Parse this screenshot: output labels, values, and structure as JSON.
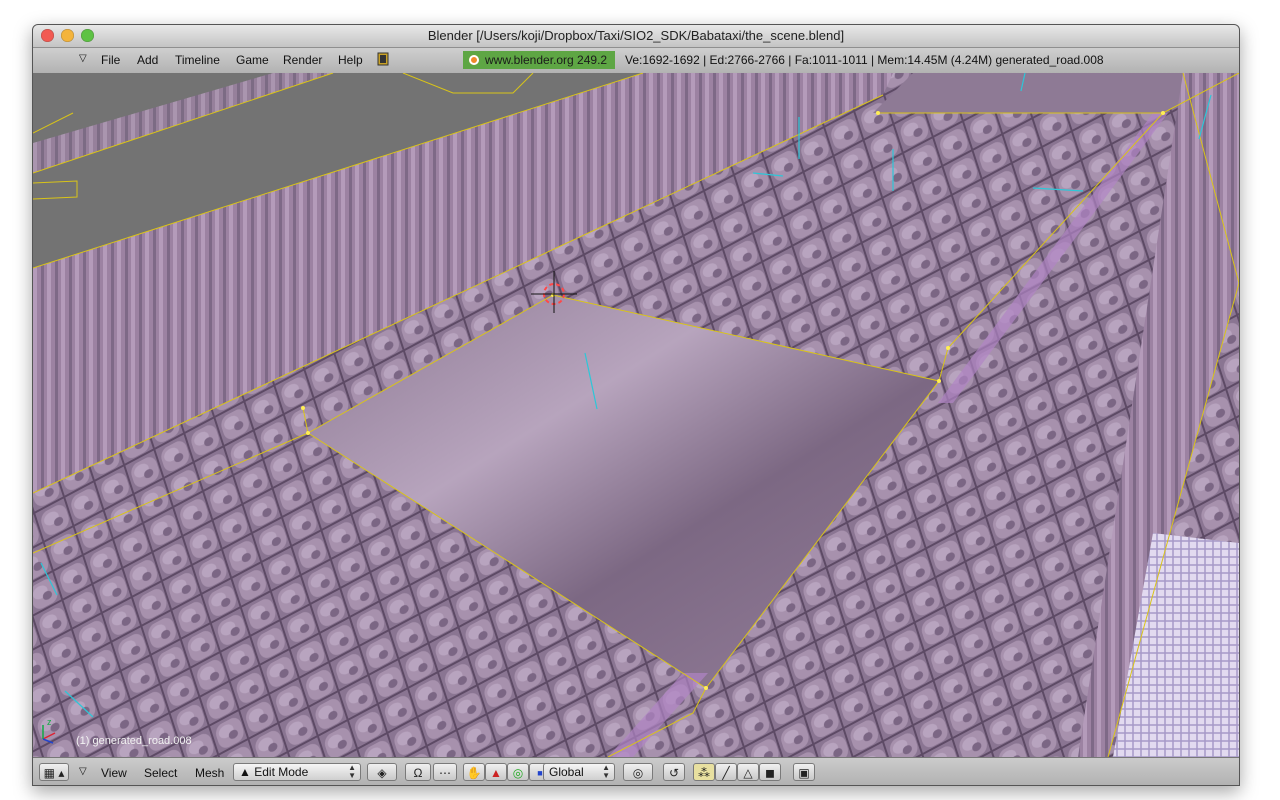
{
  "window": {
    "title": "Blender [/Users/koji/Dropbox/Taxi/SIO2_SDK/Babataxi/the_scene.blend]"
  },
  "menubar": {
    "items": [
      "File",
      "Add",
      "Timeline",
      "Game",
      "Render",
      "Help"
    ],
    "logo_text": "www.blender.org 249.2",
    "stats": "Ve:1692-1692 | Ed:2766-2766 | Fa:1011-1011 | Mem:14.45M (4.24M) generated_road.008"
  },
  "viewport": {
    "object_label": "(1) generated_road.008"
  },
  "footer": {
    "menus": [
      "View",
      "Select",
      "Mesh"
    ],
    "mode": "Edit Mode",
    "orientation": "Global"
  },
  "colors": {
    "road": "#8a7592",
    "wall": "#9a80a0",
    "edge": "#d9c418",
    "background": "#737373",
    "logo_bg": "#5ea644"
  }
}
